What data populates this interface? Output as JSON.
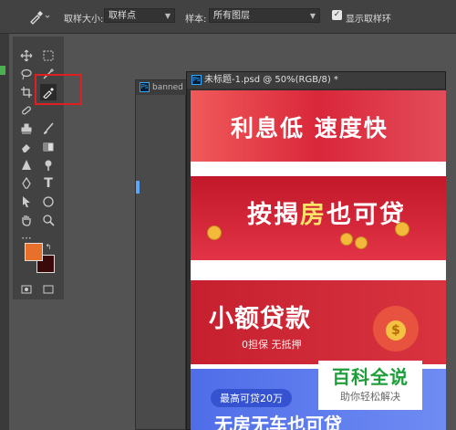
{
  "options_bar": {
    "tool_icon": "eyedropper-icon",
    "sample_size_label": "取样大小:",
    "sample_size_value": "取样点",
    "sample_label": "样本:",
    "sample_value": "所有图层",
    "show_ring_label": "显示取样环",
    "show_ring_checked": true
  },
  "toolbar": {
    "tools": [
      "move-icon",
      "marquee-icon",
      "lasso-icon",
      "magic-wand-icon",
      "crop-icon",
      "eyedropper-icon",
      "healing-brush-icon",
      "brush-icon",
      "clone-stamp-icon",
      "history-brush-icon",
      "eraser-icon",
      "gradient-icon",
      "blur-icon",
      "dodge-icon",
      "pen-icon",
      "type-icon",
      "path-selection-icon",
      "ellipse-icon",
      "hand-icon",
      "zoom-icon",
      "more-tools-icon"
    ],
    "foreground_color": "#e7712b",
    "background_color": "#3a0a0a"
  },
  "documents": {
    "back_tab": "banned",
    "front_title": "未标题-1.psd @ 50%(RGB/8) *"
  },
  "banners": {
    "b1_text": "利息低 速度快",
    "b2_part1": "按揭",
    "b2_part2": "房",
    "b2_part3": "也可贷",
    "b3_title": "小额贷款",
    "b3_sub": "0担保  无抵押",
    "b4_pill": "最高可贷20万",
    "b4_text": "无房无车也可贷"
  },
  "watermark": {
    "title": "百科全说",
    "subtitle": "助你轻松解决"
  }
}
